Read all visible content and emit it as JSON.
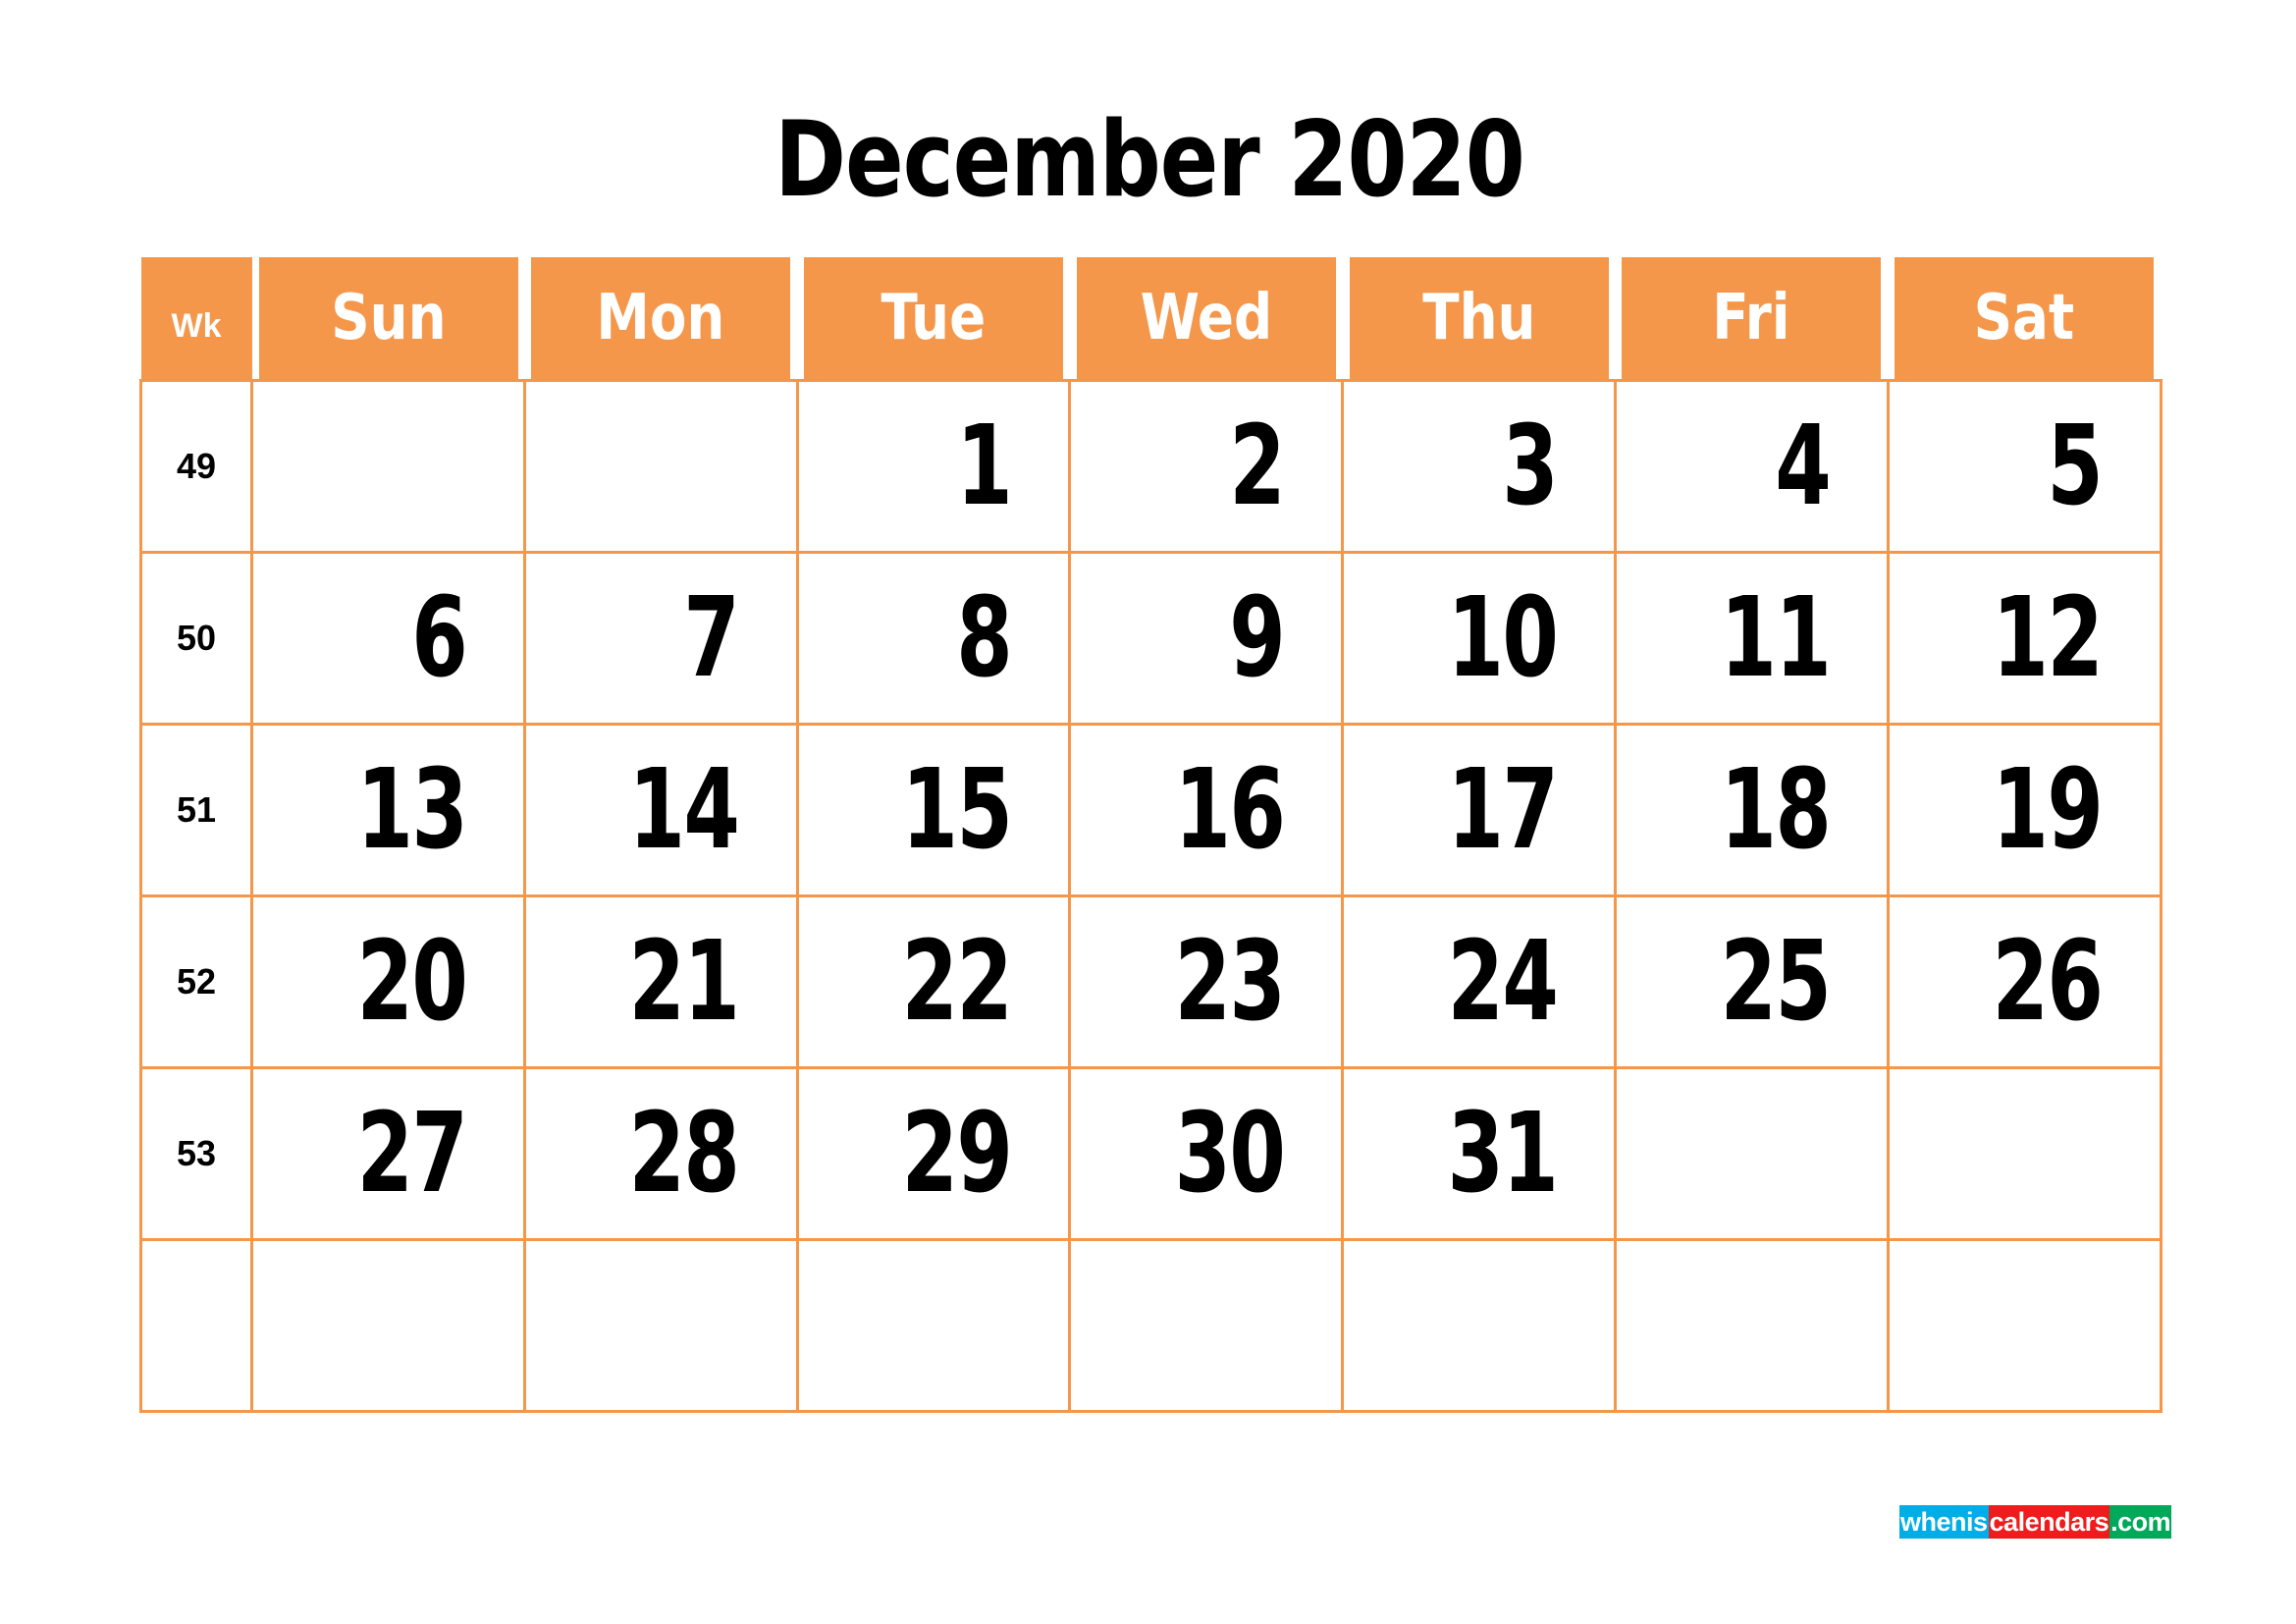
{
  "calendar": {
    "title": "December 2020",
    "month": "December",
    "year": "2020",
    "accent_color": "#f4974b",
    "header": {
      "week_label": "Wk",
      "days": [
        "Sun",
        "Mon",
        "Tue",
        "Wed",
        "Thu",
        "Fri",
        "Sat"
      ]
    },
    "weeks": [
      {
        "wk": "49",
        "days": [
          "",
          "",
          "1",
          "2",
          "3",
          "4",
          "5"
        ]
      },
      {
        "wk": "50",
        "days": [
          "6",
          "7",
          "8",
          "9",
          "10",
          "11",
          "12"
        ]
      },
      {
        "wk": "51",
        "days": [
          "13",
          "14",
          "15",
          "16",
          "17",
          "18",
          "19"
        ]
      },
      {
        "wk": "52",
        "days": [
          "20",
          "21",
          "22",
          "23",
          "24",
          "25",
          "26"
        ]
      },
      {
        "wk": "53",
        "days": [
          "27",
          "28",
          "29",
          "30",
          "31",
          "",
          ""
        ]
      },
      {
        "wk": "",
        "days": [
          "",
          "",
          "",
          "",
          "",
          "",
          ""
        ]
      }
    ]
  },
  "logo": {
    "part1": "whenis",
    "part2": "calendars",
    "part3": ".com",
    "color1": "#00ade6",
    "color2": "#ee1c1c",
    "color3": "#00a859"
  }
}
